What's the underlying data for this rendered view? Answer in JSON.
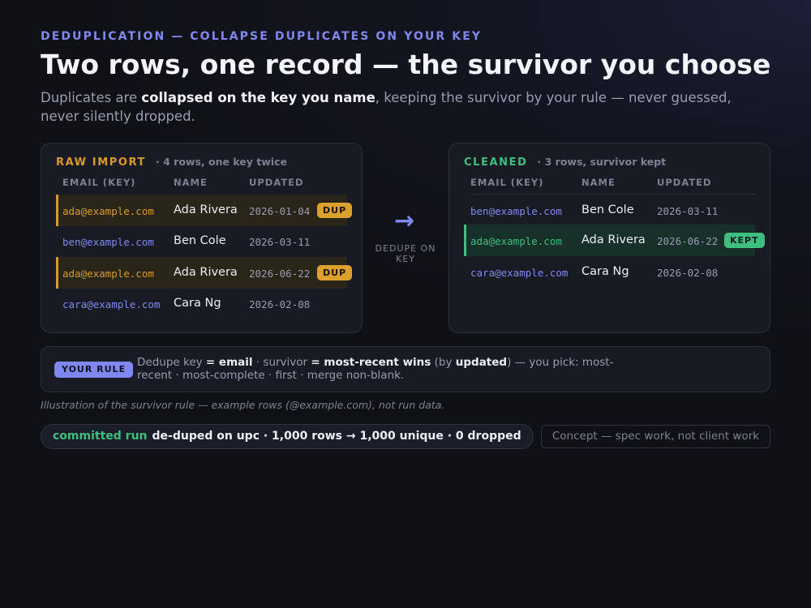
{
  "header": {
    "eyebrow": "DEDUPLICATION — COLLAPSE DUPLICATES ON YOUR KEY",
    "title": "Two rows, one record — the survivor you choose",
    "subtitle_pre": "Duplicates are ",
    "subtitle_bold": "collapsed on the key you name",
    "subtitle_post": ", keeping the survivor by your rule — never guessed, never silently dropped."
  },
  "raw": {
    "label": "RAW IMPORT",
    "meta": "· 4 rows, one key twice",
    "columns": [
      "EMAIL (KEY)",
      "NAME",
      "UPDATED"
    ],
    "rows": [
      {
        "email": "ada@example.com",
        "name": "Ada Rivera",
        "updated": "2026-01-04",
        "badge": "DUP"
      },
      {
        "email": "ben@example.com",
        "name": "Ben Cole",
        "updated": "2026-03-11",
        "badge": ""
      },
      {
        "email": "ada@example.com",
        "name": "Ada Rivera",
        "updated": "2026-06-22",
        "badge": "DUP"
      },
      {
        "email": "cara@example.com",
        "name": "Cara Ng",
        "updated": "2026-02-08",
        "badge": ""
      }
    ]
  },
  "arrow": {
    "glyph": "→",
    "label": "DEDUPE ON KEY"
  },
  "clean": {
    "label": "CLEANED",
    "meta": "· 3 rows, survivor kept",
    "columns": [
      "EMAIL (KEY)",
      "NAME",
      "UPDATED"
    ],
    "rows": [
      {
        "email": "ben@example.com",
        "name": "Ben Cole",
        "updated": "2026-03-11",
        "badge": ""
      },
      {
        "email": "ada@example.com",
        "name": "Ada Rivera",
        "updated": "2026-06-22",
        "badge": "KEPT"
      },
      {
        "email": "cara@example.com",
        "name": "Cara Ng",
        "updated": "2026-02-08",
        "badge": ""
      }
    ]
  },
  "rule": {
    "tag": "YOUR RULE",
    "t1": "Dedupe key ",
    "b1": "= email",
    "t2": "  ·  survivor ",
    "b2": "= most-recent wins",
    "t3": " (by ",
    "b3": "updated",
    "t4": ")  —  you pick: most-recent · most-complete · first · merge non-blank."
  },
  "caption": "Illustration of the survivor rule — example rows (@example.com), not run data.",
  "status": {
    "key": "committed run",
    "value": "de-duped on upc · 1,000 rows → 1,000 unique · 0 dropped"
  },
  "concept": "Concept — spec work, not client work",
  "colors": {
    "accent": "#8088f0",
    "dup": "#d99a2b",
    "kept": "#3fbf7f"
  }
}
